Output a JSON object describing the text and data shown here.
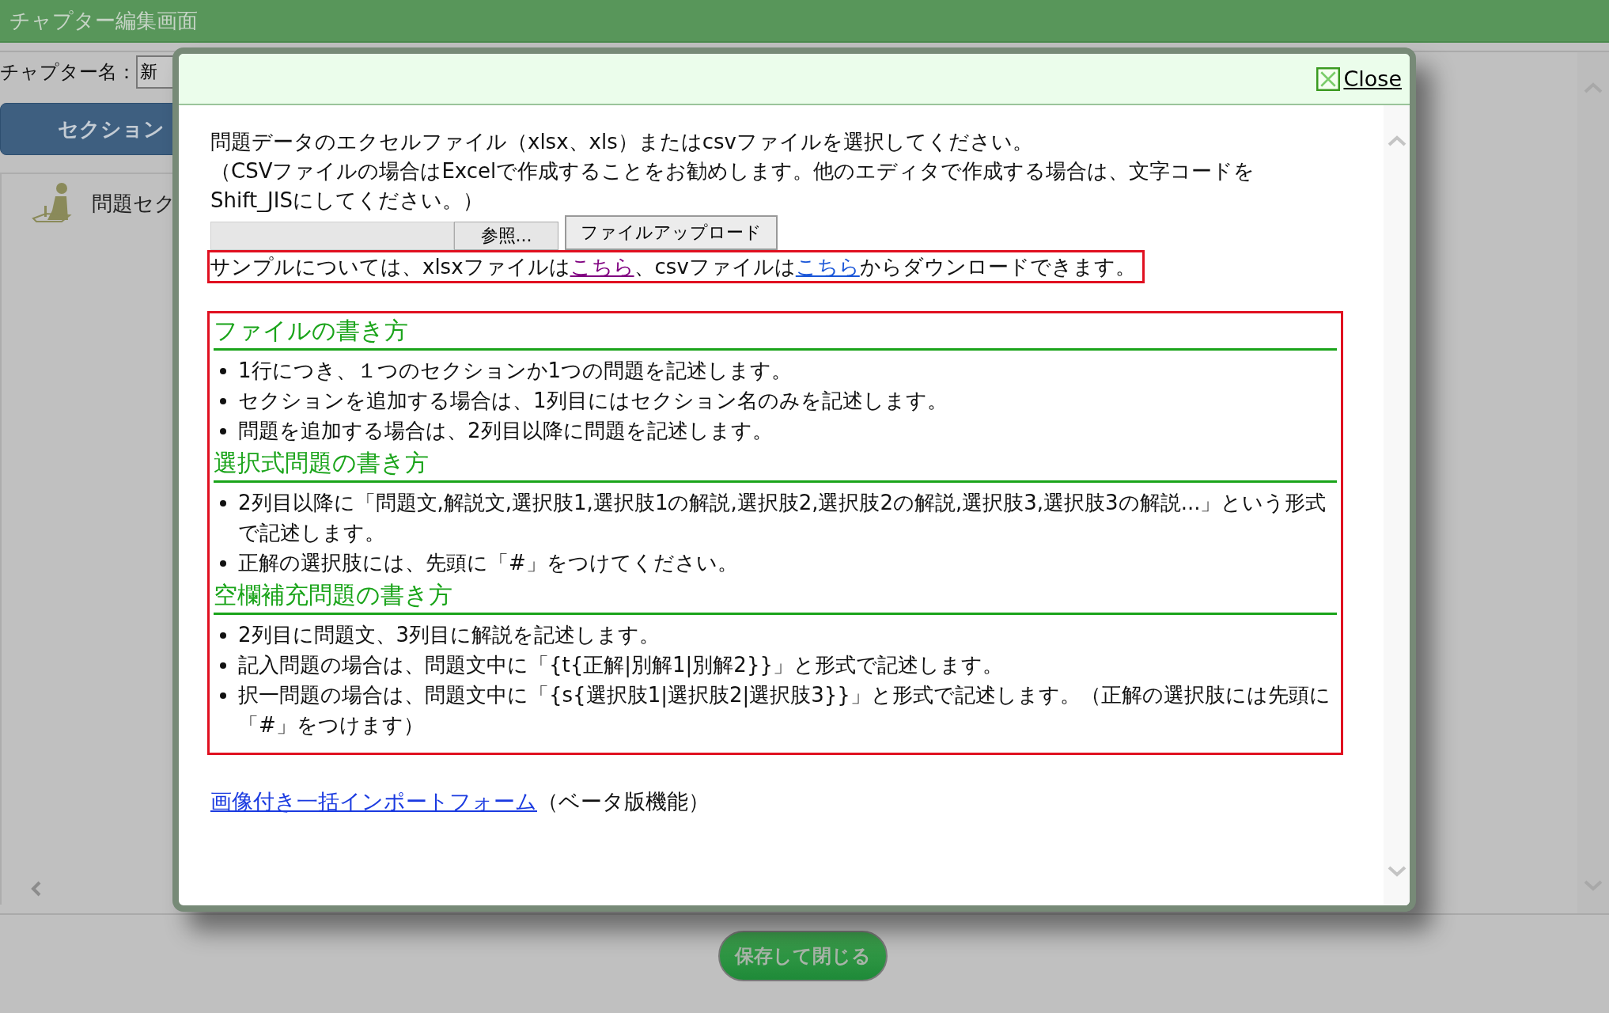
{
  "app_bar": {
    "title": "チャプター編集画面"
  },
  "chapter_name": {
    "label": "チャプター名：",
    "value": "新"
  },
  "section_button": {
    "label": "セクション"
  },
  "section_list": [
    {
      "label": "問題セク"
    }
  ],
  "dialog": {
    "close": "Close",
    "intro": [
      "問題データのエクセルファイル（xlsx、xls）またはcsvファイルを選択してください。",
      "（CSVファイルの場合はExcelで作成することをお勧めします。他のエディタで作成する場合は、文字コードをShift_JISにしてください。）"
    ],
    "browse_button": "参照...",
    "upload_button": "ファイルアップロード",
    "sample_note": [
      {
        "kind": "text",
        "text": "サンプルについては、xlsxファイルは"
      },
      {
        "kind": "link",
        "text": "こちら",
        "visited": true
      },
      {
        "kind": "text",
        "text": "、csvファイルは"
      },
      {
        "kind": "link",
        "text": "こちら",
        "visited": false
      },
      {
        "kind": "text",
        "text": "からダウンロードできます。"
      }
    ],
    "guide_sections": [
      {
        "heading": "ファイルの書き方",
        "items": [
          "1行につき、１つのセクションか1つの問題を記述します。",
          "セクションを追加する場合は、1列目にはセクション名のみを記述します。",
          "問題を追加する場合は、2列目以降に問題を記述します。"
        ]
      },
      {
        "heading": "選択式問題の書き方",
        "items": [
          "2列目以降に「問題文,解説文,選択肢1,選択肢1の解説,選択肢2,選択肢2の解説,選択肢3,選択肢3の解説...」という形式で記述します。",
          "正解の選択肢には、先頭に「#」をつけてください。"
        ]
      },
      {
        "heading": "空欄補充問題の書き方",
        "items": [
          "2列目に問題文、3列目に解説を記述します。",
          "記入問題の場合は、問題文中に「{t{正解|別解1|別解2}}」と形式で記述します。",
          "択一問題の場合は、問題文中に「{s{選択肢1|選択肢2|選択肢3}}」と形式で記述します。（正解の選択肢には先頭に「#」をつけます）"
        ]
      }
    ],
    "import_link": {
      "label": "画像付き一括インポートフォーム",
      "note": "（ベータ版機能）"
    }
  },
  "save_button": {
    "label": "保存して閉じる"
  }
}
